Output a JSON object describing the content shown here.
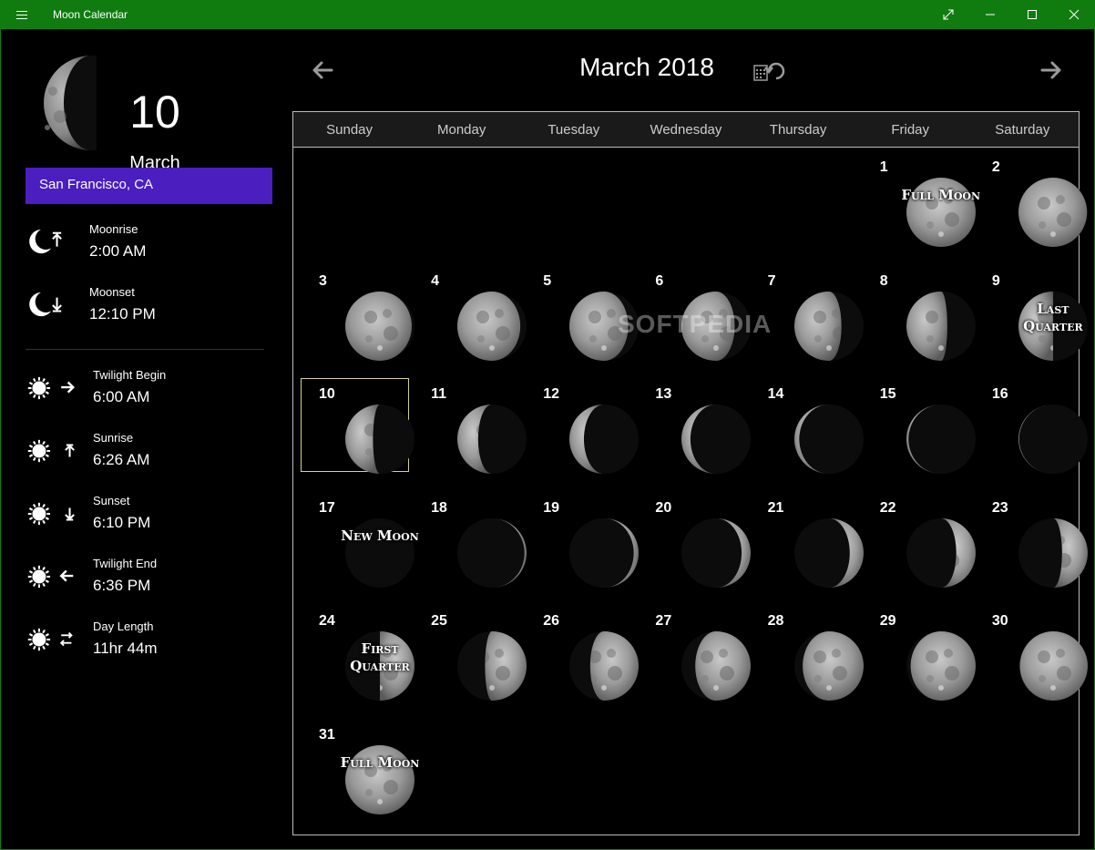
{
  "window": {
    "title": "Moon Calendar"
  },
  "selected": {
    "day": "10",
    "month": "March",
    "location": "San Francisco, CA"
  },
  "moon_times": [
    {
      "label": "Moonrise",
      "value": "2:00 AM",
      "icon": "moonrise-icon"
    },
    {
      "label": "Moonset",
      "value": "12:10 PM",
      "icon": "moonset-icon"
    }
  ],
  "sun_times": [
    {
      "label": "Twilight Begin",
      "value": "6:00 AM",
      "icon": "twilight-begin-icon"
    },
    {
      "label": "Sunrise",
      "value": "6:26 AM",
      "icon": "sunrise-icon"
    },
    {
      "label": "Sunset",
      "value": "6:10 PM",
      "icon": "sunset-icon"
    },
    {
      "label": "Twilight End",
      "value": "6:36 PM",
      "icon": "twilight-end-icon"
    },
    {
      "label": "Day Length",
      "value": "11hr 44m",
      "icon": "day-length-icon"
    }
  ],
  "calendar": {
    "title": "March 2018",
    "weekdays": [
      "Sunday",
      "Monday",
      "Tuesday",
      "Wednesday",
      "Thursday",
      "Friday",
      "Saturday"
    ],
    "first_weekday_index": 5,
    "selected_day": 10,
    "days": [
      {
        "day": "1",
        "illum": 1.0,
        "phase": "Full Moon"
      },
      {
        "day": "2",
        "illum": 0.99,
        "phase": ""
      },
      {
        "day": "3",
        "illum": 0.96,
        "phase": ""
      },
      {
        "day": "4",
        "illum": 0.91,
        "phase": ""
      },
      {
        "day": "5",
        "illum": 0.85,
        "phase": ""
      },
      {
        "day": "6",
        "illum": 0.77,
        "phase": ""
      },
      {
        "day": "7",
        "illum": 0.68,
        "phase": ""
      },
      {
        "day": "8",
        "illum": 0.59,
        "phase": ""
      },
      {
        "day": "9",
        "illum": 0.5,
        "phase": "Last Quarter"
      },
      {
        "day": "10",
        "illum": 0.4,
        "phase": ""
      },
      {
        "day": "11",
        "illum": 0.3,
        "phase": ""
      },
      {
        "day": "12",
        "illum": 0.21,
        "phase": ""
      },
      {
        "day": "13",
        "illum": 0.13,
        "phase": ""
      },
      {
        "day": "14",
        "illum": 0.07,
        "phase": ""
      },
      {
        "day": "15",
        "illum": 0.03,
        "phase": ""
      },
      {
        "day": "16",
        "illum": 0.01,
        "phase": ""
      },
      {
        "day": "17",
        "illum": 0.0,
        "phase": "New Moon"
      },
      {
        "day": "18",
        "illum": 0.03,
        "phase": ""
      },
      {
        "day": "19",
        "illum": 0.07,
        "phase": ""
      },
      {
        "day": "20",
        "illum": 0.13,
        "phase": ""
      },
      {
        "day": "21",
        "illum": 0.2,
        "phase": ""
      },
      {
        "day": "22",
        "illum": 0.28,
        "phase": ""
      },
      {
        "day": "23",
        "illum": 0.37,
        "phase": ""
      },
      {
        "day": "24",
        "illum": 0.5,
        "phase": "First Quarter"
      },
      {
        "day": "25",
        "illum": 0.6,
        "phase": ""
      },
      {
        "day": "26",
        "illum": 0.7,
        "phase": ""
      },
      {
        "day": "27",
        "illum": 0.8,
        "phase": ""
      },
      {
        "day": "28",
        "illum": 0.88,
        "phase": ""
      },
      {
        "day": "29",
        "illum": 0.94,
        "phase": ""
      },
      {
        "day": "30",
        "illum": 0.98,
        "phase": ""
      },
      {
        "day": "31",
        "illum": 1.0,
        "phase": "Full Moon"
      }
    ]
  },
  "watermark": "SOFTPEDIA",
  "colors": {
    "titlebar": "#107c10",
    "location_bg": "#4a1ebf",
    "selection_border": "#d8d28a"
  }
}
